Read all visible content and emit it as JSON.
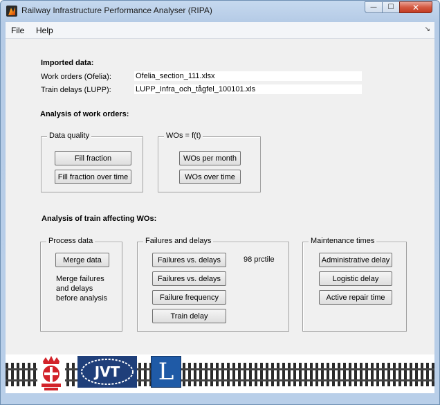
{
  "window": {
    "title": "Railway Infrastructure Performance Analyser (RIPA)",
    "minimize": "—",
    "maximize": "☐",
    "close": "✕"
  },
  "menu": {
    "file": "File",
    "help": "Help",
    "dock_arrow": "↘"
  },
  "imported": {
    "heading": "Imported data:",
    "work_orders_label": "Work orders (Ofelia):",
    "work_orders_value": "Ofelia_section_111.xlsx",
    "train_delays_label": "Train delays (LUPP):",
    "train_delays_value": "LUPP_Infra_och_tågfel_100101.xls"
  },
  "work_orders": {
    "heading": "Analysis of work orders:",
    "data_quality": {
      "title": "Data quality",
      "fill_fraction": "Fill fraction",
      "fill_fraction_over_time": "Fill fraction over time"
    },
    "wos": {
      "title": "WOs = f(t)",
      "per_month": "WOs per month",
      "over_time": "WOs over time"
    }
  },
  "train_affecting": {
    "heading": "Analysis of train affecting WOs:",
    "process": {
      "title": "Process data",
      "merge": "Merge data",
      "note_line1": "Merge failures",
      "note_line2": "and delays",
      "note_line3": "before analysis"
    },
    "failures": {
      "title": "Failures and delays",
      "btn1": "Failures vs. delays",
      "btn2": "Failures vs. delays",
      "btn3": "Failure frequency",
      "btn4": "Train delay",
      "percentile_note": "98 prctile"
    },
    "maintenance": {
      "title": "Maintenance times",
      "administrative": "Administrative delay",
      "logistic": "Logistic delay",
      "active_repair": "Active repair time"
    }
  },
  "logos": {
    "jvt": "JVT",
    "l": "L"
  },
  "colors": {
    "panel_bg": "#f0f0f0",
    "jvt_blue": "#1f3f7a",
    "l_blue": "#1f5aa6",
    "sj_red": "#d2232a"
  }
}
